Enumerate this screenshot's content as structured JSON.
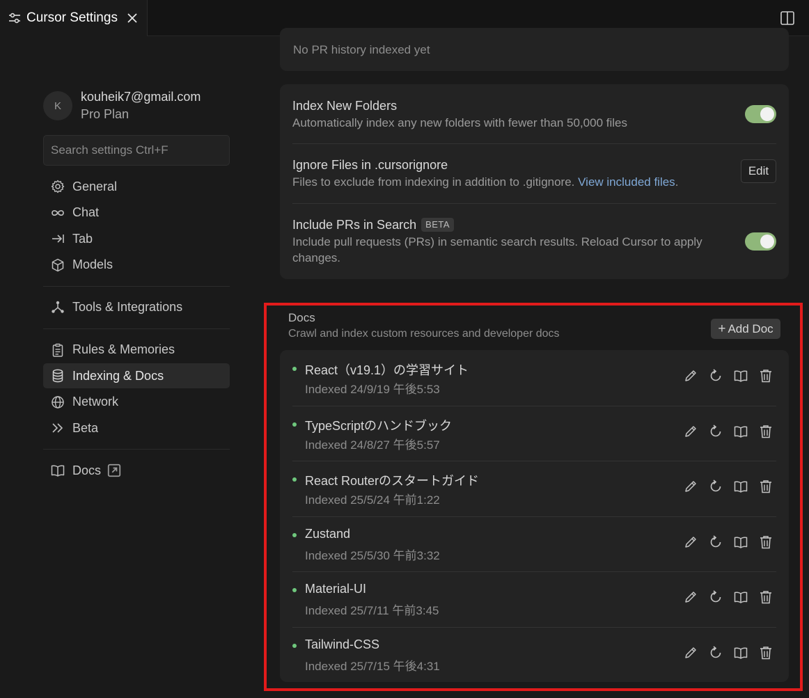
{
  "tab": {
    "title": "Cursor Settings"
  },
  "account": {
    "avatar_letter": "K",
    "email": "kouheik7@gmail.com",
    "plan": "Pro Plan"
  },
  "search": {
    "placeholder": "Search settings Ctrl+F"
  },
  "nav": {
    "general": "General",
    "chat": "Chat",
    "tab": "Tab",
    "models": "Models",
    "tools": "Tools & Integrations",
    "rules": "Rules & Memories",
    "indexing": "Indexing & Docs",
    "network": "Network",
    "beta": "Beta",
    "docs": "Docs"
  },
  "pr_history": {
    "text": "No PR history indexed yet"
  },
  "settings": {
    "index_new_folders": {
      "title": "Index New Folders",
      "desc": "Automatically index any new folders with fewer than 50,000 files",
      "enabled": true
    },
    "ignore_files": {
      "title": "Ignore Files in .cursorignore",
      "desc": "Files to exclude from indexing in addition to .gitignore.",
      "link": "View included files",
      "link_suffix": ".",
      "button": "Edit"
    },
    "include_prs": {
      "title": "Include PRs in Search",
      "badge": "BETA",
      "desc": "Include pull requests (PRs) in semantic search results. Reload Cursor to apply changes.",
      "enabled": true
    }
  },
  "docs_section": {
    "title": "Docs",
    "subtitle": "Crawl and index custom resources and developer docs",
    "add_button": "Add Doc",
    "items": [
      {
        "name": "React（v19.1）の学習サイト",
        "indexed": "Indexed 24/9/19 午後5:53"
      },
      {
        "name": "TypeScriptのハンドブック",
        "indexed": "Indexed 24/8/27 午後5:57"
      },
      {
        "name": "React Routerのスタートガイド",
        "indexed": "Indexed 25/5/24 午前1:22"
      },
      {
        "name": "Zustand",
        "indexed": "Indexed 25/5/30 午前3:32"
      },
      {
        "name": "Material-UI",
        "indexed": "Indexed 25/7/11 午前3:45"
      },
      {
        "name": "Tailwind-CSS",
        "indexed": "Indexed 25/7/15 午後4:31"
      }
    ]
  },
  "colors": {
    "highlight": "#e11b1b",
    "toggle_on": "#8fb77a",
    "status_dot": "#6fc77d",
    "link": "#7fa8d6"
  }
}
